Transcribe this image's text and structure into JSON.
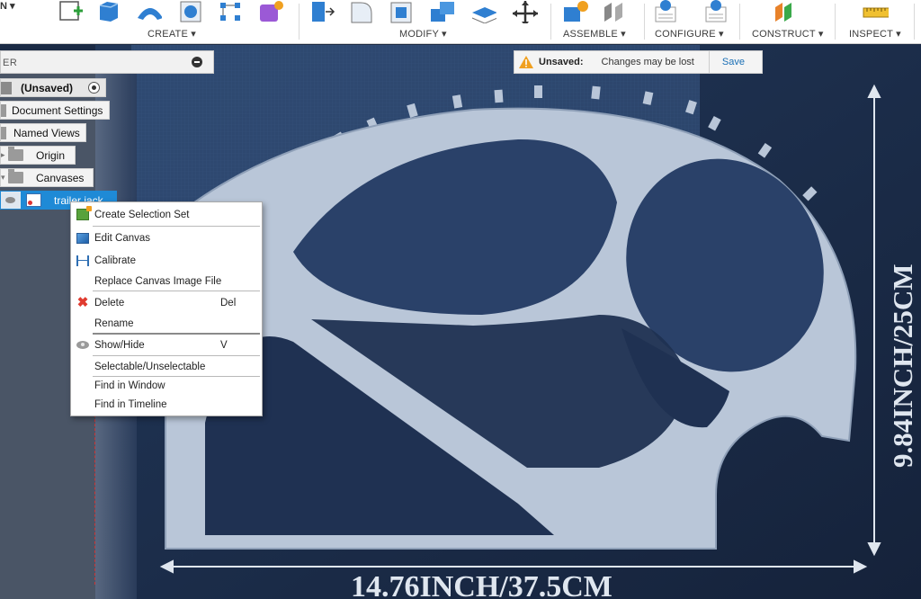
{
  "toolbar": {
    "partial_label": "N ▾",
    "groups": [
      {
        "label": "CREATE ▾"
      },
      {
        "label": "MODIFY ▾"
      },
      {
        "label": "ASSEMBLE ▾"
      },
      {
        "label": "CONFIGURE ▾"
      },
      {
        "label": "CONSTRUCT ▾"
      },
      {
        "label": "INSPECT ▾"
      }
    ]
  },
  "unsaved_bar": {
    "label": "Unsaved:",
    "message": "Changes may be lost",
    "save_label": "Save"
  },
  "browser": {
    "title": "ER",
    "tree": {
      "root": "(Unsaved)",
      "document_settings": "Document Settings",
      "named_views": "Named Views",
      "origin": "Origin",
      "canvases": "Canvases",
      "canvas_item": "trailer jack"
    }
  },
  "context_menu": {
    "items": [
      {
        "label": "Create Selection Set",
        "icon": "selection-set-icon",
        "shortcut": ""
      },
      {
        "label": "Edit Canvas",
        "icon": "edit-canvas-icon",
        "shortcut": ""
      },
      {
        "label": "Calibrate",
        "icon": "calibrate-icon",
        "shortcut": ""
      },
      {
        "label": "Replace Canvas Image File",
        "icon": "",
        "shortcut": ""
      },
      {
        "label": "Delete",
        "icon": "delete-icon",
        "shortcut": "Del"
      },
      {
        "label": "Rename",
        "icon": "",
        "shortcut": ""
      },
      {
        "label": "Show/Hide",
        "icon": "eye-icon",
        "shortcut": "V"
      },
      {
        "label": "Selectable/Unselectable",
        "icon": "",
        "shortcut": ""
      },
      {
        "label": "Find in Window",
        "icon": "",
        "shortcut": ""
      },
      {
        "label": "Find in Timeline",
        "icon": "",
        "shortcut": ""
      }
    ]
  },
  "canvas_image": {
    "height_annotation": "9.84INCH/25CM",
    "width_annotation": "14.76INCH/37.5CM"
  },
  "colors": {
    "canvas_bg": "#1d2d4a",
    "selection_blue": "#1f8ad6",
    "part_metal": "#b9c6d8",
    "annotation_text": "#dfe6ef"
  }
}
